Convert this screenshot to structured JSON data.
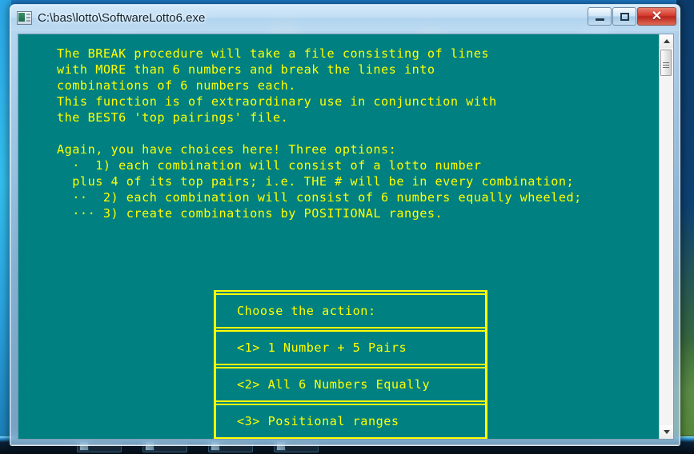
{
  "window": {
    "title": "C:\\bas\\lotto\\SoftwareLotto6.exe",
    "icon": "console-app-icon",
    "controls": {
      "minimize_label": "–",
      "maximize_label": "□",
      "close_label": "✕"
    },
    "colors": {
      "console_background": "#008080",
      "console_text": "#ffff00",
      "close_button": "#d4392c",
      "frame_glass": "#b6d6ed"
    }
  },
  "console": {
    "paragraph1": [
      "The BREAK procedure will take a file consisting of lines",
      "with MORE than 6 numbers and break the lines into",
      "combinations of 6 numbers each.",
      "This function is of extraordinary use in conjunction with",
      "the BEST6 'top pairings' file."
    ],
    "paragraph2": [
      "Again, you have choices here! Three options:",
      "  ·  1) each combination will consist of a lotto number",
      "  plus 4 of its top pairs; i.e. THE # will be in every combination;",
      "  ··  2) each combination will consist of 6 numbers equally wheeled;",
      "  ··· 3) create combinations by POSITIONAL ranges."
    ]
  },
  "menu": {
    "header": "Choose the action:",
    "options": [
      "<1> 1 Number + 5 Pairs",
      "<2> All 6 Numbers Equally",
      "<3> Positional ranges"
    ]
  },
  "scrollbar": {
    "up_arrow": "scroll-up-arrow",
    "down_arrow": "scroll-down-arrow",
    "thumb": "scroll-thumb"
  }
}
